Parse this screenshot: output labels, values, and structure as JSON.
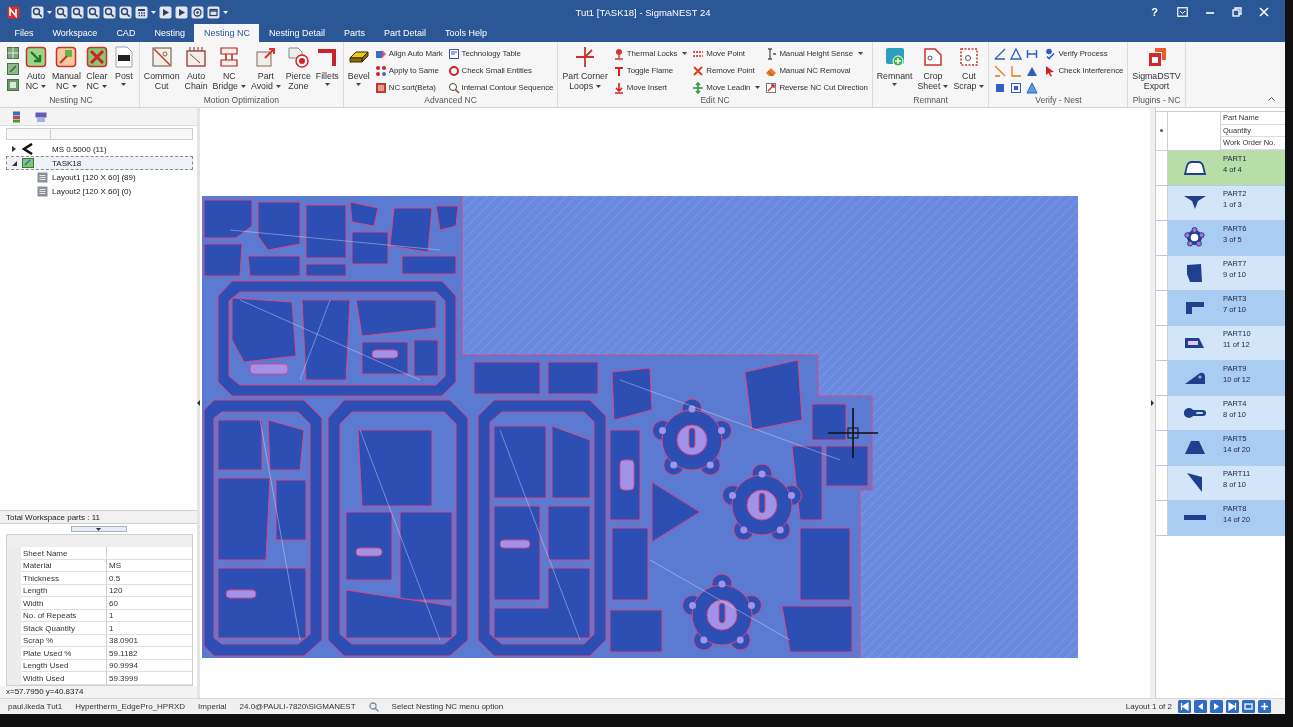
{
  "window": {
    "title": "Tut1 [TASK18] - SigmaNEST 24",
    "help": "?"
  },
  "tabs": [
    {
      "label": "Files",
      "selected": false
    },
    {
      "label": "Workspace",
      "selected": false
    },
    {
      "label": "CAD",
      "selected": false
    },
    {
      "label": "Nesting",
      "selected": false
    },
    {
      "label": "Nesting NC",
      "selected": true
    },
    {
      "label": "Nesting Detail",
      "selected": false
    },
    {
      "label": "Parts",
      "selected": false
    },
    {
      "label": "Part Detail",
      "selected": false
    },
    {
      "label": "Tools Help",
      "selected": false
    }
  ],
  "ribbon": [
    {
      "label": "Nesting NC",
      "items": [
        {
          "kind": "icon_stack"
        },
        {
          "kind": "large",
          "label": "Auto\nNC",
          "dropdown": true
        },
        {
          "kind": "large",
          "label": "Manual\nNC",
          "dropdown": true
        },
        {
          "kind": "large",
          "label": "Clear\nNC",
          "dropdown": true
        },
        {
          "kind": "large",
          "label": "Post",
          "dropdown": true
        }
      ]
    },
    {
      "label": "Motion Optimization",
      "items": [
        {
          "kind": "large",
          "label": "Common\nCut",
          "dropdown": false
        },
        {
          "kind": "large",
          "label": "Auto\nChain",
          "dropdown": false
        },
        {
          "kind": "large",
          "label": "NC\nBridge",
          "dropdown": true
        },
        {
          "kind": "large",
          "label": "Part\nAvoid",
          "dropdown": true
        },
        {
          "kind": "large",
          "label": "Pierce\nZone",
          "dropdown": false
        },
        {
          "kind": "large",
          "label": "Fillets",
          "dropdown": true
        }
      ]
    },
    {
      "label": "Advanced NC",
      "items": [
        {
          "kind": "large",
          "label": "Bevel",
          "dropdown": true
        },
        {
          "kind": "column",
          "buttons": [
            {
              "label": "Align Auto Mark",
              "dropdown": false
            },
            {
              "label": "Apply to Same",
              "dropdown": false
            },
            {
              "label": "NC sort(Beta)",
              "dropdown": false
            }
          ]
        },
        {
          "kind": "column",
          "buttons": [
            {
              "label": "Technology Table",
              "dropdown": false
            },
            {
              "label": "Check Small Entities",
              "dropdown": false
            },
            {
              "label": "Internal Contour Sequence",
              "dropdown": false
            }
          ]
        }
      ]
    },
    {
      "label": "Edit NC",
      "items": [
        {
          "kind": "large",
          "label": "Part Corner\nLoops",
          "dropdown": true
        },
        {
          "kind": "column",
          "buttons": [
            {
              "label": "Thermal Locks",
              "dropdown": true
            },
            {
              "label": "Toggle Flame",
              "dropdown": false
            },
            {
              "label": "Move Insert",
              "dropdown": false
            }
          ]
        },
        {
          "kind": "column",
          "buttons": [
            {
              "label": "Move Point",
              "dropdown": false
            },
            {
              "label": "Remove Point",
              "dropdown": false
            },
            {
              "label": "Move Leadin",
              "dropdown": true
            }
          ]
        },
        {
          "kind": "column",
          "buttons": [
            {
              "label": "Manual Height Sense",
              "dropdown": true
            },
            {
              "label": "Manual NC Removal",
              "dropdown": false
            },
            {
              "label": "Reverse NC Cut Direction",
              "dropdown": false
            }
          ]
        }
      ]
    },
    {
      "label": "Remnant",
      "items": [
        {
          "kind": "large",
          "label": "Remnant",
          "dropdown": true
        },
        {
          "kind": "large",
          "label": "Crop\nSheet",
          "dropdown": true
        },
        {
          "kind": "large",
          "label": "Cut\nScrap",
          "dropdown": true
        }
      ]
    },
    {
      "label": "Verify - Nest",
      "items": [
        {
          "kind": "icon_grid"
        },
        {
          "kind": "column",
          "buttons": [
            {
              "label": "Verify Process",
              "dropdown": false
            },
            {
              "label": "Check Interference",
              "dropdown": false
            }
          ]
        }
      ]
    },
    {
      "label": "Plugins - NC",
      "items": [
        {
          "kind": "large",
          "label": "SigmaDSTV\nExport",
          "dropdown": false
        }
      ]
    }
  ],
  "tree": [
    {
      "label": "MS 0.5000 (11)",
      "expanded": false,
      "selected": false
    },
    {
      "label": "TASK18",
      "expanded": true,
      "selected": true,
      "children": [
        {
          "label": "Layout1 [120 X 60] (89)",
          "selected": false
        },
        {
          "label": "Layout2 [120 X 60] (0)",
          "selected": false
        }
      ]
    }
  ],
  "workspace_total": "Total Workspace parts : 11",
  "properties": [
    {
      "name": "Sheet Name"
    },
    {
      "name": "Material",
      "value": "MS"
    },
    {
      "name": "Thickness",
      "value": "0.5"
    },
    {
      "name": "Length",
      "value": "120"
    },
    {
      "name": "Width",
      "value": "60"
    },
    {
      "name": "No. of Repeats",
      "value": "1"
    },
    {
      "name": "Stack Quantity",
      "value": "1"
    },
    {
      "name": "Scrap %",
      "value": "38.0901"
    },
    {
      "name": "Plate Used %",
      "value": "59.1182"
    },
    {
      "name": "Length Used",
      "value": "90.9994"
    },
    {
      "name": "Width Used",
      "value": "59.3999"
    }
  ],
  "cursor_position": "x=57.7950 y=40.8374",
  "parts": {
    "columns": [
      "Part Name",
      "Quantity",
      "Work Order No."
    ],
    "rows": [
      {
        "name": "PART1",
        "quantity": "4 of 4",
        "selected": true
      },
      {
        "name": "PART2",
        "quantity": "1 of 3",
        "selected": false
      },
      {
        "name": "PART6",
        "quantity": "3 of 5",
        "selected": false
      },
      {
        "name": "PART7",
        "quantity": "9 of 10",
        "selected": false
      },
      {
        "name": "PART3",
        "quantity": "7 of 10",
        "selected": false
      },
      {
        "name": "PART10",
        "quantity": "11 of 12",
        "selected": false
      },
      {
        "name": "PART9",
        "quantity": "10 of 12",
        "selected": false
      },
      {
        "name": "PART4",
        "quantity": "8 of 10",
        "selected": false
      },
      {
        "name": "PART5",
        "quantity": "14 of 20",
        "selected": false
      },
      {
        "name": "PART11",
        "quantity": "8 of 10",
        "selected": false
      },
      {
        "name": "PART8",
        "quantity": "14 of 20",
        "selected": false
      }
    ]
  },
  "status_bar": {
    "items": [
      "paul.ikeda Tut1",
      "Hypertherm_EdgePro_HPRXD",
      "Imperial",
      "24.0@PAULI-7820\\SIGMANEST"
    ],
    "message": "Select Nesting NC menu option",
    "layout": "Layout 1 of 2"
  }
}
